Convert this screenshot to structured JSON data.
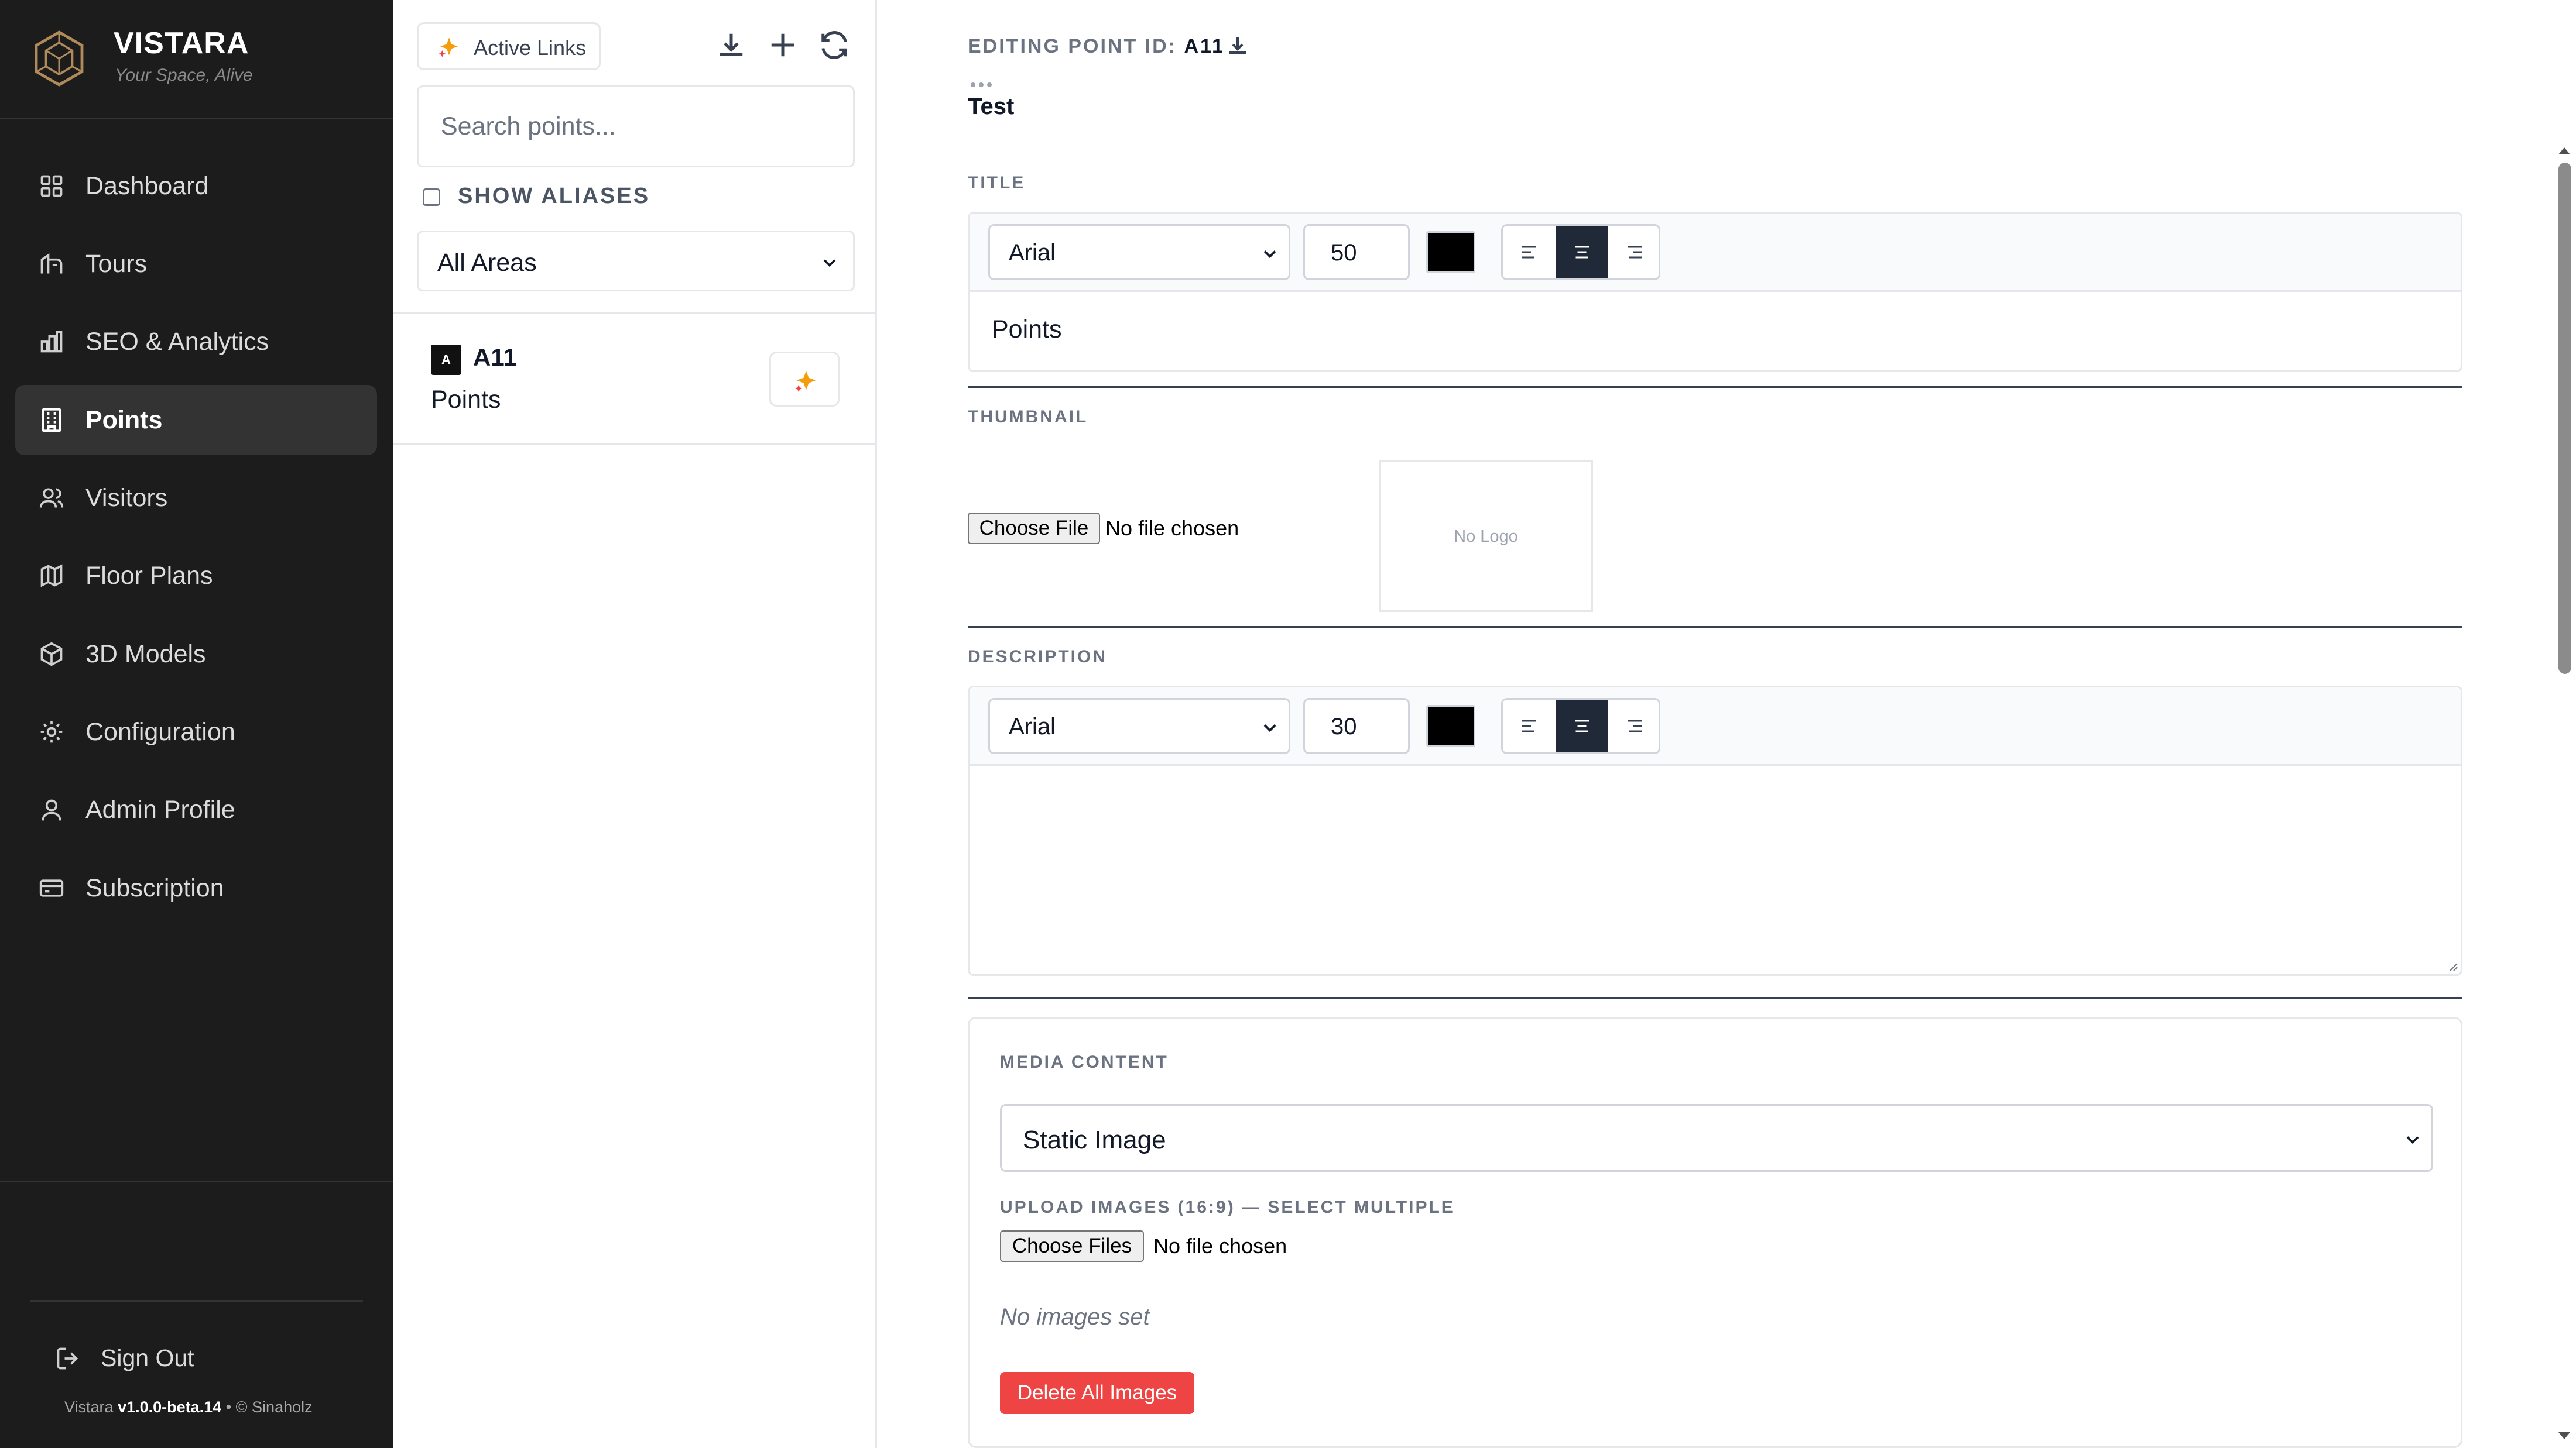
{
  "brand": {
    "name": "VISTARA",
    "tagline": "Your Space, Alive"
  },
  "sidebar": {
    "items": [
      {
        "label": "Dashboard",
        "icon": "grid-icon"
      },
      {
        "label": "Tours",
        "icon": "tour-icon"
      },
      {
        "label": "SEO & Analytics",
        "icon": "bar-chart-icon"
      },
      {
        "label": "Points",
        "icon": "building-icon",
        "active": true
      },
      {
        "label": "Visitors",
        "icon": "users-icon"
      },
      {
        "label": "Floor Plans",
        "icon": "map-icon"
      },
      {
        "label": "3D Models",
        "icon": "cube-icon"
      },
      {
        "label": "Configuration",
        "icon": "gear-icon"
      },
      {
        "label": "Admin Profile",
        "icon": "user-icon"
      },
      {
        "label": "Subscription",
        "icon": "card-icon"
      }
    ],
    "signout": "Sign Out",
    "footer": {
      "app": "Vistara",
      "version": "v1.0.0-beta.14",
      "sep": "•",
      "copyright": "© Sinaholz"
    }
  },
  "list": {
    "active_links_label": "Active Links",
    "search_placeholder": "Search points...",
    "show_aliases_label": "SHOW ALIASES",
    "area_filter": "All Areas",
    "points": [
      {
        "badge": "A",
        "id": "A11",
        "title": "Points"
      }
    ]
  },
  "editor": {
    "editing_prefix": "EDITING POINT ID:",
    "editing_id": "A11",
    "point_name": "Test",
    "title_section": {
      "label": "TITLE",
      "font": "Arial",
      "size": "50",
      "color": "#000000",
      "align": "center",
      "value": "Points"
    },
    "thumbnail_section": {
      "label": "THUMBNAIL",
      "file_button": "Choose File",
      "file_status": "No file chosen",
      "preview_placeholder": "No Logo"
    },
    "description_section": {
      "label": "DESCRIPTION",
      "font": "Arial",
      "size": "30",
      "color": "#000000",
      "align": "center",
      "value": ""
    },
    "media_section": {
      "label": "MEDIA CONTENT",
      "type": "Static Image",
      "upload_label": "UPLOAD IMAGES (16:9) — SELECT MULTIPLE",
      "file_button": "Choose Files",
      "file_status": "No file chosen",
      "empty_text": "No images set",
      "delete_button": "Delete All Images",
      "delete_color": "#ef4444"
    }
  }
}
